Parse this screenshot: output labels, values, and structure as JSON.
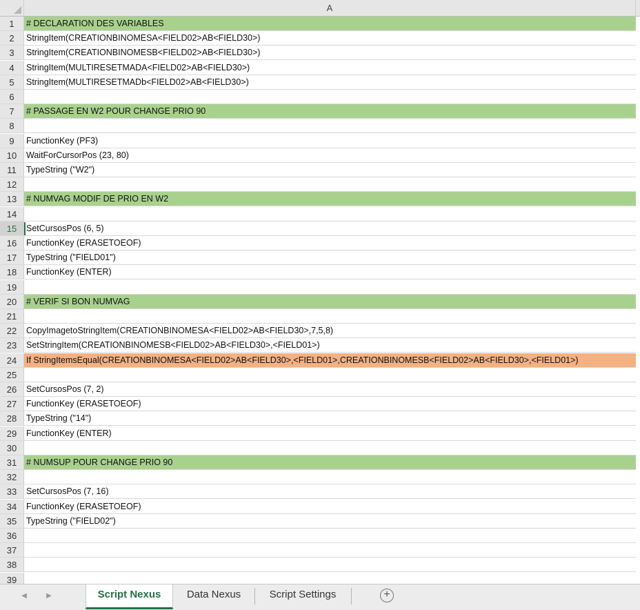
{
  "sheet": {
    "column_header": "A",
    "active_row": "15",
    "rows": [
      {
        "num": "1",
        "text": "# DECLARATION DES VARIABLES",
        "fill": "green"
      },
      {
        "num": "2",
        "text": "StringItem(CREATIONBINOMESA<FIELD02>AB<FIELD30>)",
        "fill": ""
      },
      {
        "num": "3",
        "text": "StringItem(CREATIONBINOMESB<FIELD02>AB<FIELD30>)",
        "fill": ""
      },
      {
        "num": "4",
        "text": "StringItem(MULTIRESETMADA<FIELD02>AB<FIELD30>)",
        "fill": ""
      },
      {
        "num": "5",
        "text": "StringItem(MULTIRESETMADb<FIELD02>AB<FIELD30>)",
        "fill": ""
      },
      {
        "num": "6",
        "text": "",
        "fill": ""
      },
      {
        "num": "7",
        "text": "# PASSAGE EN W2 POUR CHANGE PRIO 90",
        "fill": "green"
      },
      {
        "num": "8",
        "text": "",
        "fill": ""
      },
      {
        "num": "9",
        "text": "FunctionKey (PF3)",
        "fill": ""
      },
      {
        "num": "10",
        "text": "WaitForCursorPos (23, 80)",
        "fill": ""
      },
      {
        "num": "11",
        "text": "TypeString (\"W2\")",
        "fill": ""
      },
      {
        "num": "12",
        "text": "",
        "fill": ""
      },
      {
        "num": "13",
        "text": "# NUMVAG MODIF DE PRIO EN W2",
        "fill": "green"
      },
      {
        "num": "14",
        "text": "",
        "fill": ""
      },
      {
        "num": "15",
        "text": "SetCursosPos (6, 5)",
        "fill": ""
      },
      {
        "num": "16",
        "text": "FunctionKey (ERASETOEOF)",
        "fill": ""
      },
      {
        "num": "17",
        "text": "TypeString (\"FIELD01\")",
        "fill": ""
      },
      {
        "num": "18",
        "text": "FunctionKey (ENTER)",
        "fill": ""
      },
      {
        "num": "19",
        "text": "",
        "fill": ""
      },
      {
        "num": "20",
        "text": "# VERIF SI BON NUMVAG",
        "fill": "green"
      },
      {
        "num": "21",
        "text": "",
        "fill": ""
      },
      {
        "num": "22",
        "text": "CopyImagetoStringItem(CREATIONBINOMESA<FIELD02>AB<FIELD30>,7,5,8)",
        "fill": ""
      },
      {
        "num": "23",
        "text": "SetStringItem(CREATIONBINOMESB<FIELD02>AB<FIELD30>,<FIELD01>)",
        "fill": ""
      },
      {
        "num": "24",
        "text": "If StringItemsEqual(CREATIONBINOMESA<FIELD02>AB<FIELD30>,<FIELD01>,CREATIONBINOMESB<FIELD02>AB<FIELD30>,<FIELD01>)",
        "fill": "orange"
      },
      {
        "num": "25",
        "text": "",
        "fill": ""
      },
      {
        "num": "26",
        "text": "SetCursosPos (7, 2)",
        "fill": ""
      },
      {
        "num": "27",
        "text": "FunctionKey (ERASETOEOF)",
        "fill": ""
      },
      {
        "num": "28",
        "text": "TypeString (\"14\")",
        "fill": ""
      },
      {
        "num": "29",
        "text": "FunctionKey (ENTER)",
        "fill": ""
      },
      {
        "num": "30",
        "text": "",
        "fill": ""
      },
      {
        "num": "31",
        "text": "# NUMSUP POUR CHANGE PRIO 90",
        "fill": "green"
      },
      {
        "num": "32",
        "text": "",
        "fill": ""
      },
      {
        "num": "33",
        "text": "SetCursosPos (7, 16)",
        "fill": ""
      },
      {
        "num": "34",
        "text": "FunctionKey (ERASETOEOF)",
        "fill": ""
      },
      {
        "num": "35",
        "text": "TypeString (\"FIELD02\")",
        "fill": ""
      },
      {
        "num": "36",
        "text": "",
        "fill": ""
      },
      {
        "num": "37",
        "text": "",
        "fill": ""
      },
      {
        "num": "38",
        "text": "",
        "fill": ""
      },
      {
        "num": "39",
        "text": "",
        "fill": ""
      }
    ],
    "fill_colors": {
      "green": "#a9d18e",
      "orange": "#f4b183"
    }
  },
  "tabs": {
    "items": [
      {
        "label": "Script Nexus",
        "active": true
      },
      {
        "label": "Data Nexus",
        "active": false
      },
      {
        "label": "Script Settings",
        "active": false
      }
    ],
    "add_icon": "plus-circle-icon",
    "prev_icon": "chevron-left-icon",
    "next_icon": "chevron-right-icon",
    "accent": "#217346"
  }
}
